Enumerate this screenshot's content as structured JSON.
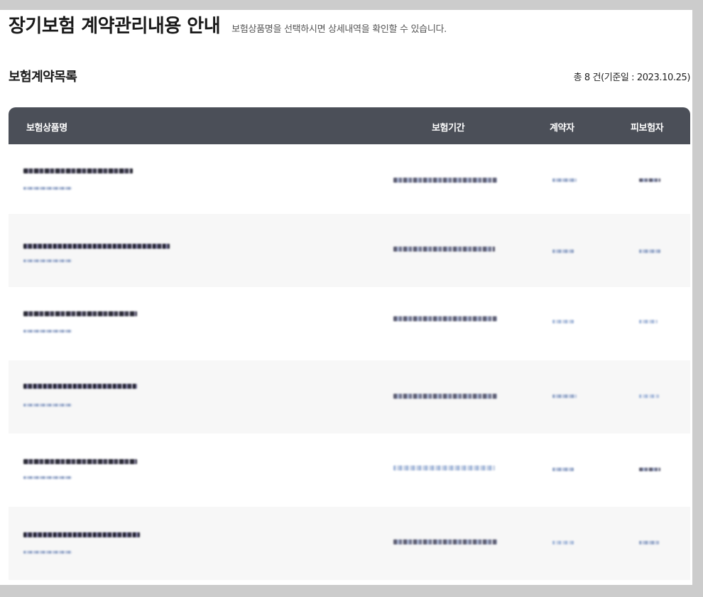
{
  "header": {
    "title": "장기보험 계약관리내용 안내",
    "description": "보험상품명을 선택하시면 상세내역을 확인할 수 있습니다."
  },
  "section": {
    "title": "보험계약목록",
    "summary": "총 8 건(기준일 : 2023.10.25)"
  },
  "table": {
    "columns": [
      "보험상품명",
      "보험기간",
      "계약자",
      "피보험자"
    ],
    "rows": [
      {
        "blurred": true
      },
      {
        "blurred": true
      },
      {
        "blurred": true
      },
      {
        "blurred": true
      },
      {
        "blurred": true
      },
      {
        "blurred": true
      }
    ]
  },
  "colors": {
    "header_bg": "#4b4f58",
    "alt_row_bg": "#f7f7f7",
    "frame_bg": "#cccccc"
  }
}
